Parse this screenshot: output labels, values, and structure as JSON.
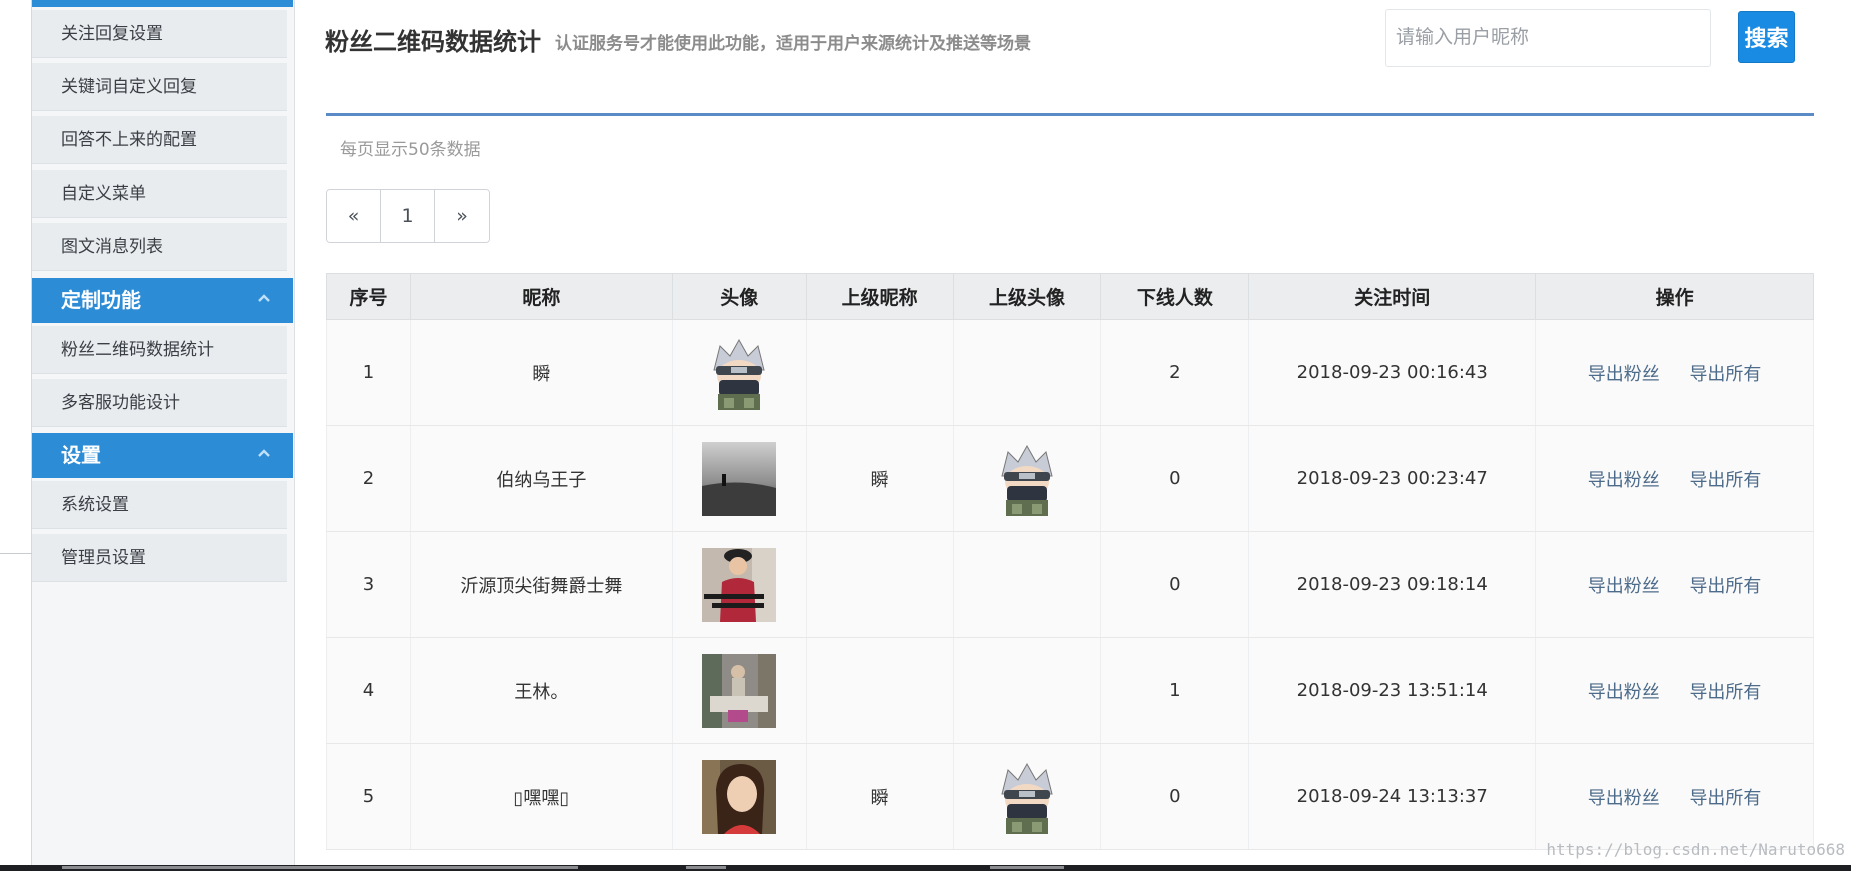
{
  "sidebar": {
    "items_top": [
      {
        "label": "关注回复设置"
      },
      {
        "label": "关键词自定义回复"
      },
      {
        "label": "回答不上来的配置"
      },
      {
        "label": "自定义菜单"
      },
      {
        "label": "图文消息列表"
      }
    ],
    "group_custom": {
      "label": "定制功能"
    },
    "items_custom": [
      {
        "label": "粉丝二维码数据统计"
      },
      {
        "label": "多客服功能设计"
      }
    ],
    "group_settings": {
      "label": "设置"
    },
    "items_settings": [
      {
        "label": "系统设置"
      },
      {
        "label": "管理员设置"
      }
    ]
  },
  "header": {
    "title": "粉丝二维码数据统计",
    "subtitle": "认证服务号才能使用此功能，适用于用户来源统计及推送等场景",
    "search_placeholder": "请输入用户昵称",
    "search_button": "搜索"
  },
  "page_info": "每页显示50条数据",
  "pager": {
    "prev": "«",
    "current": "1",
    "next": "»"
  },
  "table": {
    "headers": [
      "序号",
      "昵称",
      "头像",
      "上级昵称",
      "上级头像",
      "下线人数",
      "关注时间",
      "操作"
    ],
    "rows": [
      {
        "index": "1",
        "nickname": "瞬",
        "avatar": "ninja-avatar",
        "parent_nickname": "",
        "parent_avatar": "",
        "downline": "2",
        "follow_time": "2018-09-23 00:16:43",
        "op1": "导出粉丝",
        "op2": "导出所有"
      },
      {
        "index": "2",
        "nickname": "伯纳乌王子",
        "avatar": "beach-photo-avatar",
        "parent_nickname": "瞬",
        "parent_avatar": "ninja-avatar",
        "downline": "0",
        "follow_time": "2018-09-23 00:23:47",
        "op1": "导出粉丝",
        "op2": "导出所有"
      },
      {
        "index": "3",
        "nickname": "沂源顶尖街舞爵士舞",
        "avatar": "dancer-photo-avatar",
        "parent_nickname": "",
        "parent_avatar": "",
        "downline": "0",
        "follow_time": "2018-09-23 09:18:14",
        "op1": "导出粉丝",
        "op2": "导出所有"
      },
      {
        "index": "4",
        "nickname": "王林。",
        "avatar": "love-sign-photo-avatar",
        "parent_nickname": "",
        "parent_avatar": "",
        "downline": "1",
        "follow_time": "2018-09-23 13:51:14",
        "op1": "导出粉丝",
        "op2": "导出所有"
      },
      {
        "index": "5",
        "nickname": "▯嘿嘿▯",
        "avatar": "girl-photo-avatar",
        "parent_nickname": "瞬",
        "parent_avatar": "ninja-avatar",
        "downline": "0",
        "follow_time": "2018-09-24 13:13:37",
        "op1": "导出粉丝",
        "op2": "导出所有"
      }
    ]
  },
  "watermark": "https://blog.csdn.net/Naruto668",
  "colors": {
    "accent": "#2d8cd6",
    "button": "#1a8be3",
    "divider": "#5a8bc7"
  }
}
